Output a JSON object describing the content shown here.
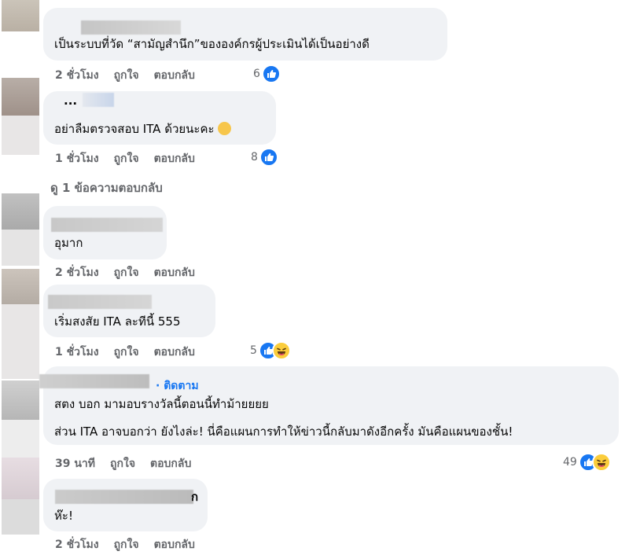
{
  "comments": [
    {
      "text": "เป็นระบบที่วัด “สามัญสำนึก”ขององค์กรผู้ประเมินได้เป็นอย่างดี",
      "time": "2 ชั่วโมง",
      "like": "ถูกใจ",
      "reply": "ตอบกลับ",
      "count": "6"
    },
    {
      "name": "...",
      "text": "อย่าลืมตรวจสอบ ITA ด้วยนะคะ",
      "time": "1 ชั่วโมง",
      "like": "ถูกใจ",
      "reply": "ตอบกลับ",
      "count": "8",
      "view_replies": "ดู 1 ข้อความตอบกลับ"
    },
    {
      "text": "อุมาก",
      "time": "2 ชั่วโมง",
      "like": "ถูกใจ",
      "reply": "ตอบกลับ"
    },
    {
      "text": "เริ่มสงสัย ITA ละทีนี้ 555",
      "time": "1 ชั่วโมง",
      "like": "ถูกใจ",
      "reply": "ตอบกลับ",
      "count": "5"
    },
    {
      "follow": "· ติดตาม",
      "text1": "สตง บอก มามอบรางวัลนี้ตอนนี้ทำม้ายยยย",
      "text2": "ส่วน ITA อาจบอกว่า ยังไงล่ะ! นี่คือแผนการทำให้ข่าวนี้กลับมาดังอีกครั้ง มันคือแผนของชั้น!",
      "time": "39 นาที",
      "like": "ถูกใจ",
      "reply": "ตอบกลับ",
      "count": "49"
    },
    {
      "name_tail": "ก",
      "text": "ห๊ะ!",
      "time": "2 ชั่วโมง",
      "like": "ถูกใจ",
      "reply": "ตอบกลับ"
    }
  ],
  "icons": {
    "like": "like-thumb-icon",
    "haha": "haha-laugh-icon",
    "emoji": "smile-emoji-icon"
  }
}
